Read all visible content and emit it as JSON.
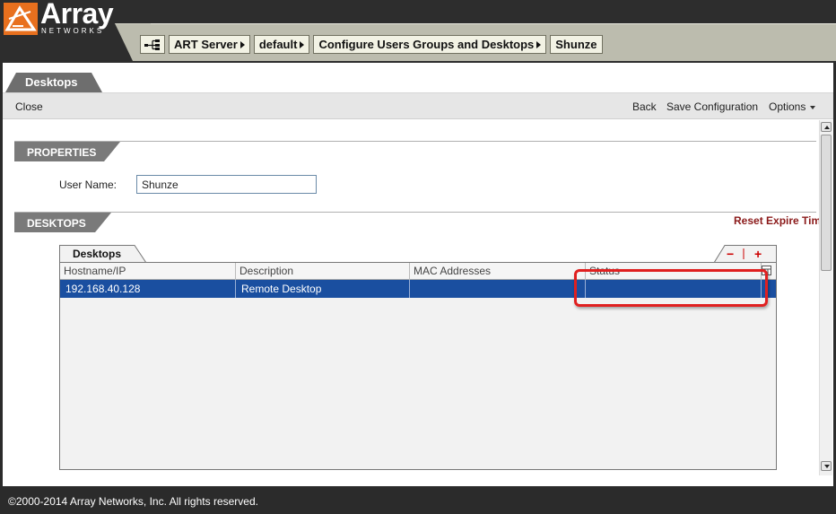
{
  "header": {
    "logo_text": "Array",
    "logo_sub": "NETWORKS",
    "logo_color": "#e8701e",
    "breadcrumbs": [
      {
        "label": "ART Server"
      },
      {
        "label": "default"
      },
      {
        "label": "Configure Users Groups and Desktops"
      },
      {
        "label": "Shunze"
      }
    ],
    "breadcrumb_icon": "network-tree-icon"
  },
  "page_tab": {
    "label": "Desktops"
  },
  "toolbar": {
    "close_label": "Close",
    "back_label": "Back",
    "save_label": "Save Configuration",
    "options_label": "Options"
  },
  "properties": {
    "section_label": "PROPERTIES",
    "username_label": "User Name:",
    "username_value": "Shunze"
  },
  "desktops": {
    "section_label": "DESKTOPS",
    "reset_link": "Reset Expire Tim",
    "grid_tab_label": "Desktops",
    "actions": {
      "minus": "−",
      "plus": "+"
    },
    "columns": [
      "Hostname/IP",
      "Description",
      "MAC Addresses",
      "Status"
    ],
    "rows": [
      {
        "hostname": "192.168.40.128",
        "description": "Remote Desktop",
        "mac": "",
        "status": ""
      }
    ],
    "selected_row_color": "#1a4fa0"
  },
  "annotation": {
    "highlight_color": "#e02020"
  },
  "footer": {
    "copyright": "©2000-2014 Array Networks, Inc. All rights reserved."
  }
}
